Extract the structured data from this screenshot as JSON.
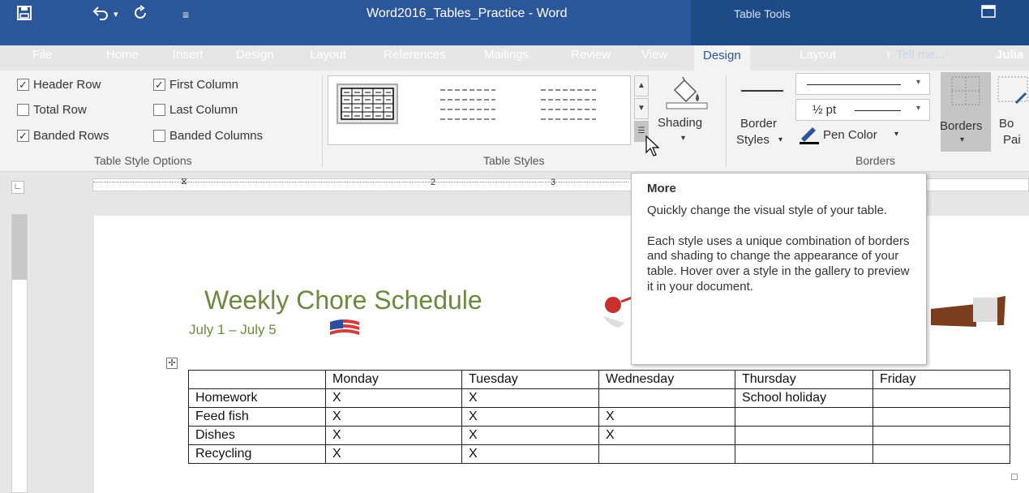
{
  "titlebar": {
    "title": "Word2016_Tables_Practice - Word",
    "context_label": "Table Tools"
  },
  "tabs": [
    "File",
    "Home",
    "Insert",
    "Design",
    "Layout",
    "References",
    "Mailings",
    "Review",
    "View",
    "Design",
    "Layout"
  ],
  "tell_me": "Tell me...",
  "user": "Julia",
  "ribbon": {
    "table_style_options": {
      "label": "Table Style Options",
      "options": [
        {
          "label": "Header Row",
          "checked": true
        },
        {
          "label": "First Column",
          "checked": true
        },
        {
          "label": "Total Row",
          "checked": false
        },
        {
          "label": "Last Column",
          "checked": false
        },
        {
          "label": "Banded Rows",
          "checked": true
        },
        {
          "label": "Banded Columns",
          "checked": false
        }
      ]
    },
    "table_styles": {
      "label": "Table Styles",
      "shading": "Shading"
    },
    "borders": {
      "label": "Borders",
      "border_styles_1": "Border",
      "border_styles_2": "Styles",
      "pen_weight": "½ pt",
      "pen_color": "Pen Color",
      "borders_btn": "Borders",
      "border_painter_1": "Bo",
      "border_painter_2": "Pai"
    }
  },
  "ruler_marks": [
    "2",
    "3"
  ],
  "document": {
    "heading": "Weekly Chore Schedule",
    "subheading": "July 1 – July 5",
    "table": {
      "header": [
        "",
        "Monday",
        "Tuesday",
        "Wednesday",
        "Thursday",
        "Friday"
      ],
      "rows": [
        [
          "Homework",
          "X",
          "X",
          "",
          "School holiday",
          ""
        ],
        [
          "Feed fish",
          "X",
          "X",
          "X",
          "",
          ""
        ],
        [
          "Dishes",
          "X",
          "X",
          "X",
          "",
          ""
        ],
        [
          "Recycling",
          "X",
          "X",
          "",
          "",
          ""
        ]
      ]
    }
  },
  "tooltip": {
    "title": "More",
    "line1": "Quickly change the visual style of your table.",
    "line2": "Each style uses a unique combination of borders and shading to change the appearance of your table. Hover over a style in the gallery to preview it in your document."
  },
  "colors": {
    "titlebar": "#2b579a",
    "heading": "#6b8a3f"
  }
}
